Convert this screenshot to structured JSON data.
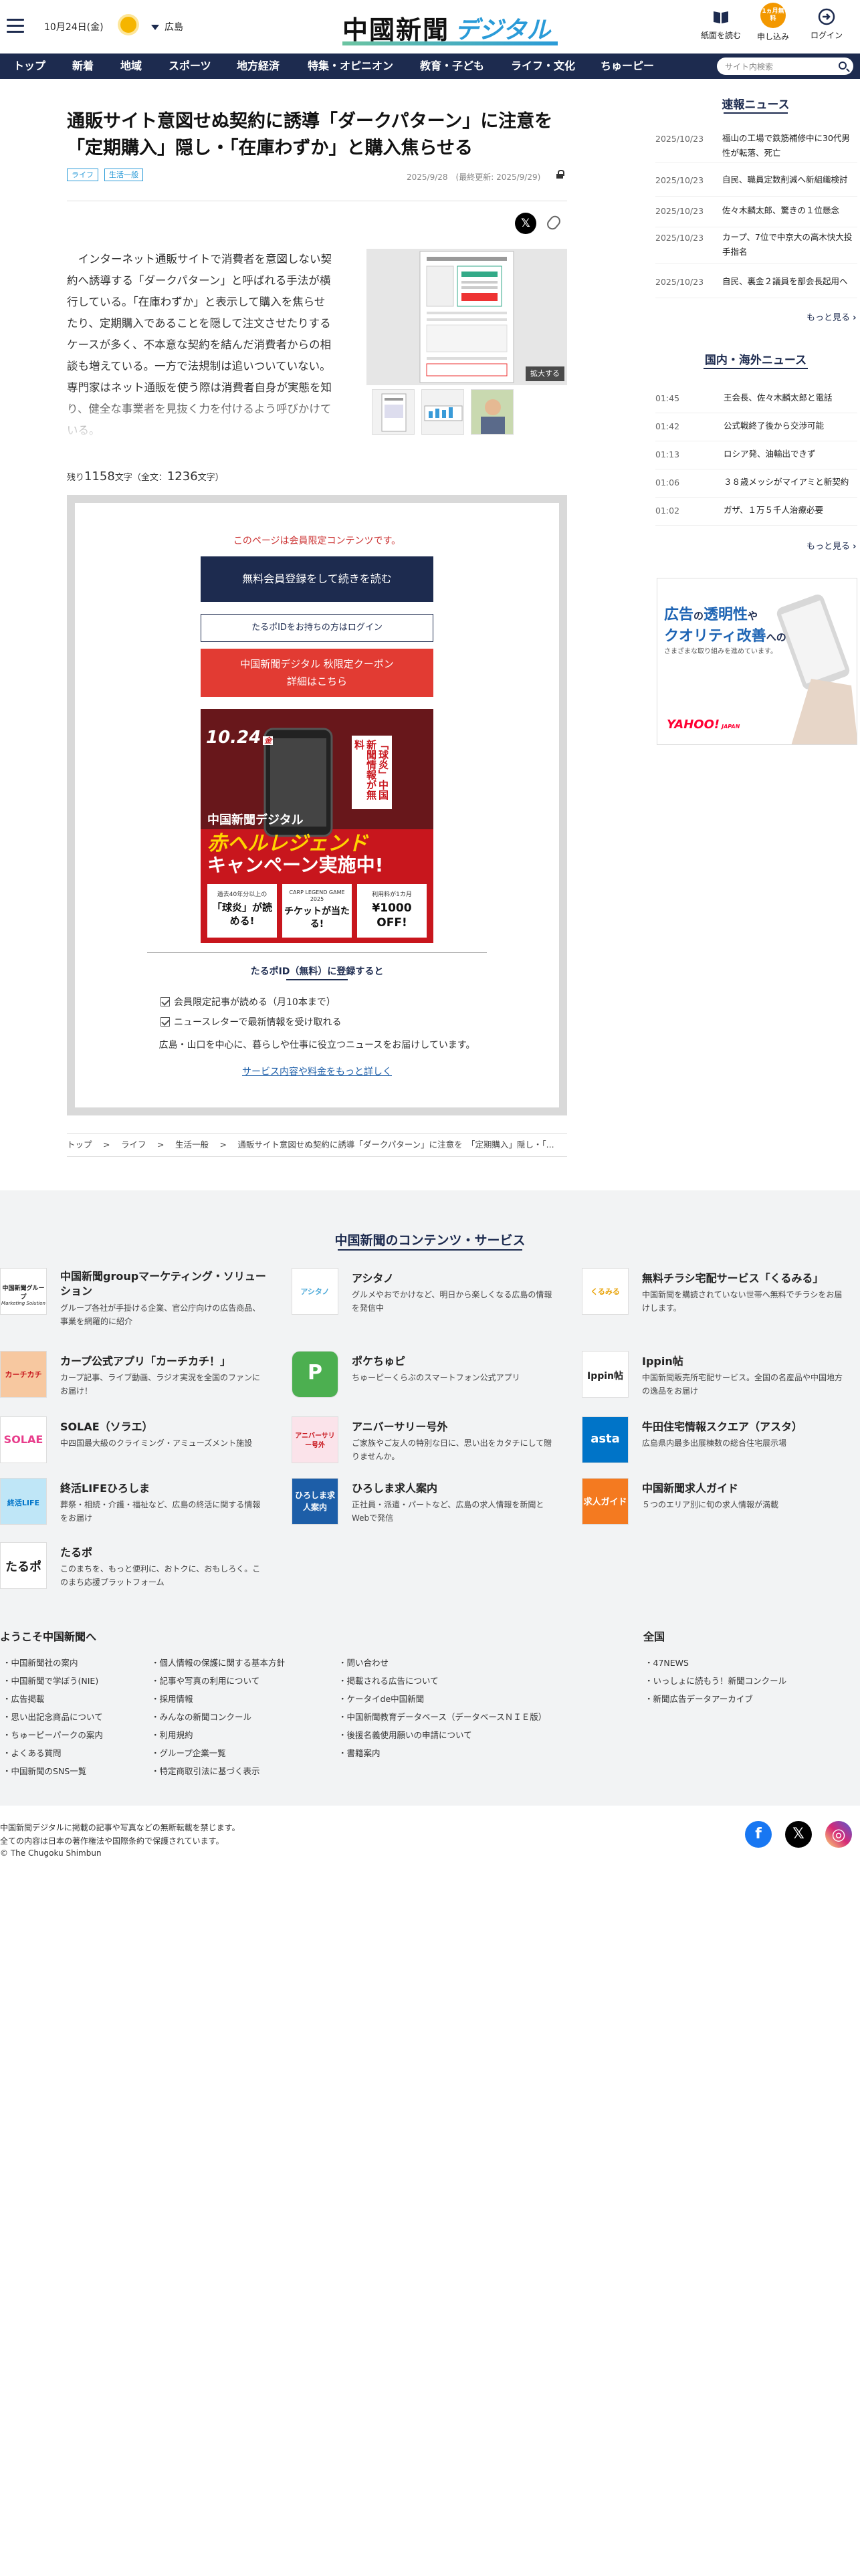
{
  "header": {
    "date": "10月24日(金)",
    "weather_icon": "sun-icon",
    "prefecture": "広島",
    "logo_main": "中國新聞",
    "logo_sub": "デジタル",
    "buttons": [
      {
        "label": "紙面を読む",
        "icon": "newspaper-icon"
      },
      {
        "label": "申し込み",
        "icon": "apply-badge-icon",
        "badge": "1ヵ月無料"
      },
      {
        "label": "ログイン",
        "icon": "login-icon"
      }
    ]
  },
  "nav": {
    "items": [
      "トップ",
      "新着",
      "地域",
      "スポーツ",
      "地方経済",
      "特集・オピニオン",
      "教育・子ども",
      "ライフ・文化",
      "ちゅーピー"
    ],
    "search_placeholder": "サイト内検索"
  },
  "article": {
    "title": "通販サイト意図せぬ契約に誘導「ダークパターン」に注意を　「定期購入」隠し・「在庫わずか」と購入焦らせる",
    "tags": [
      "ライフ",
      "生活一般"
    ],
    "published": "2025/9/28　(最終更新: 2025/9/29)",
    "share_x": "𝕏",
    "lead": "インターネット通販サイトで消費者を意図しない契約へ誘導する「ダークパターン」と呼ばれる手法が横行している。「在庫わずか」と表示して購入を焦らせたり、定期購入であることを隠して注文させたりするケースが多く、不本意な契約を結んだ消費者からの相談も増えている。一方で法規制は追いついていない。専門家はネット通販を使う際は消費者自身が実態を知り、健全な事業者を見抜く力を付けるよう呼びかけている。",
    "expand_label": "拡大する",
    "remaining_prefix": "残り",
    "remaining_count": "1158",
    "remaining_mid": "文字（全文：",
    "total_count": "1236",
    "remaining_suffix": "文字）"
  },
  "paywall": {
    "notice": "このページは会員限定コンテンツです。",
    "register_button": "無料会員登録をして続きを読む",
    "login_button": "たるポIDをお持ちの方はログイン",
    "coupon_line1": "中国新聞デジタル 秋限定クーポン",
    "coupon_line2": "詳細はこちら",
    "promo": {
      "date": "10.24",
      "day": "金",
      "vertical_text": "「球炎」中国新聞情報が無料",
      "brand": "中国新聞デジタル",
      "campaign_red": "赤ヘルレジェンド",
      "campaign": "キャンペーン実施中!",
      "box1_small": "過去40年分以上の",
      "box1_big": "「球炎」が読める!",
      "box2_small": "CARP LEGEND GAME 2025",
      "box2_big": "チケットが当たる!",
      "box3_small": "利用料が1カ月",
      "box3_big": "¥1000 OFF!"
    },
    "benefits_title": "たるポID（無料）に登録すると",
    "benefits": [
      "会員限定記事が読める（月10本まで）",
      "ニュースレターで最新情報を受け取れる"
    ],
    "description": "広島・山口を中心に、暮らしや仕事に役立つニュースをお届けしています。",
    "more_link": "サービス内容や料金をもっと詳しく"
  },
  "breadcrumb": [
    "トップ",
    "ライフ",
    "生活一般",
    "通販サイト意図せぬ契約に誘導「ダークパターン」に注意を　「定期購入」隠し・「..."
  ],
  "sidebar": {
    "breaking_title": "速報ニュース",
    "breaking": [
      {
        "time": "2025/10/23",
        "text": "福山の工場で鉄筋補修中に30代男性が転落、死亡"
      },
      {
        "time": "2025/10/23",
        "text": "自民、職員定数削減へ新組織検討"
      },
      {
        "time": "2025/10/23",
        "text": "佐々木麟太郎、驚きの１位懸念"
      },
      {
        "time": "2025/10/23",
        "text": "カープ、7位で中京大の高木快大投手指名"
      },
      {
        "time": "2025/10/23",
        "text": "自民、裏金２議員を部会長起用へ"
      }
    ],
    "more": "もっと見る",
    "world_title": "国内・海外ニュース",
    "world": [
      {
        "time": "01:45",
        "text": "王会長、佐々木麟太郎と電話"
      },
      {
        "time": "01:42",
        "text": "公式戦終了後から交渉可能"
      },
      {
        "time": "01:13",
        "text": "ロシア発、油輸出できず"
      },
      {
        "time": "01:06",
        "text": "３８歳メッシがマイアミと新契約"
      },
      {
        "time": "01:02",
        "text": "ガザ、１万５千人治療必要"
      }
    ],
    "ad": {
      "line1a": "広告",
      "line1b": "の",
      "line1c": "透明性",
      "line1d": "や",
      "line2a": "クオリティ改善",
      "line2b": "への",
      "line3": "さまざまな取り組みを進めています。",
      "brand": "YAHOO!",
      "brand_sub": "JAPAN"
    }
  },
  "services": {
    "title": "中国新聞のコンテンツ・サービス",
    "items": [
      {
        "name": "中国新聞groupマーケティング・ソリューション",
        "desc": "グループ各社が手掛ける企業、官公庁向けの広告商品、事業を網羅的に紹介",
        "logo": "中国新聞グループ",
        "logo_sub": "Marketing Solution"
      },
      {
        "name": "アシタノ",
        "desc": "グルメやおでかけなど、明日から楽しくなる広島の情報を発信中",
        "logo": "アシタノ"
      },
      {
        "name": "無料チラシ宅配サービス「くるみる」",
        "desc": "中国新聞を購読されていない世帯へ無料でチラシをお届けします。",
        "logo": "くるみる"
      },
      {
        "name": "カープ公式アプリ「カーチカチ！」",
        "desc": "カープ記事、ライブ動画、ラジオ実況を全国のファンにお届け！",
        "logo": "カーチカチ"
      },
      {
        "name": "ポケちゅピ",
        "desc": "ちゅーピーくらぶのスマートフォン公式アプリ",
        "logo": "P"
      },
      {
        "name": "Ippin帖",
        "desc": "中国新聞販売所宅配サービス。全国の名産品や中国地方の逸品をお届け",
        "logo": "Ippin帖"
      },
      {
        "name": "SOLAE（ソラエ）",
        "desc": "中四国最大級のクライミング・アミューズメント施設",
        "logo": "SOLAE"
      },
      {
        "name": "アニバーサリー号外",
        "desc": "ご家族やご友人の特別な日に、思い出をカタチにして贈りませんか。",
        "logo": "アニバーサリー号外"
      },
      {
        "name": "牛田住宅情報スクエア（アスタ）",
        "desc": "広島県内最多出展棟数の総合住宅展示場",
        "logo": "asta"
      },
      {
        "name": "終活LIFEひろしま",
        "desc": "葬祭・相続・介護・福祉など、広島の終活に関する情報をお届け",
        "logo": "終活LIFE"
      },
      {
        "name": "ひろしま求人案内",
        "desc": "正社員・派遣・パートなど、広島の求人情報を新聞とWebで発信",
        "logo": "ひろしま求人案内"
      },
      {
        "name": "中国新聞求人ガイド",
        "desc": "５つのエリア別に旬の求人情報が満載",
        "logo": "求人ガイド"
      },
      {
        "name": "たるポ",
        "desc": "このまちを、もっと便利に、おトクに、おもしろく。このまち応援プラットフォーム",
        "logo": "たるポ"
      }
    ]
  },
  "footer": {
    "welcome_title": "ようこそ中国新聞へ",
    "col1": [
      "中国新聞社の案内",
      "中国新聞で学ぼう(NIE)",
      "広告掲載",
      "思い出記念商品について",
      "ちゅーピーパークの案内",
      "よくある質問",
      "中国新聞のSNS一覧"
    ],
    "col2": [
      "個人情報の保護に関する基本方針",
      "記事や写真の利用について",
      "採用情報",
      "みんなの新聞コンクール",
      "利用規約",
      "グループ企業一覧",
      "特定商取引法に基づく表示"
    ],
    "col3": [
      "問い合わせ",
      "掲載される広告について",
      "ケータイde中国新聞",
      "中国新聞教育データベース（データベースＮＩＥ版）",
      "後援名義使用願いの申請について",
      "書籍案内"
    ],
    "national_title": "全国",
    "national": [
      "47NEWS",
      "いっしょに読もう！新聞コンクール",
      "新聞広告データアーカイブ"
    ],
    "notice1": "中国新聞デジタルに掲載の記事や写真などの無断転載を禁じます。",
    "notice2": "全ての内容は日本の著作権法や国際条約で保護されています。",
    "copyright": "© The Chugoku Shimbun",
    "social": [
      {
        "icon": "facebook-icon",
        "color": "#1877f2",
        "glyph": "f"
      },
      {
        "icon": "x-icon",
        "color": "#000000",
        "glyph": "𝕏"
      },
      {
        "icon": "instagram-icon",
        "color": "#d62976",
        "glyph": "◎"
      }
    ]
  },
  "colors": {
    "navy": "#1d2b4f",
    "accent": "#2a9bd8",
    "red": "#e23b33",
    "orange": "#f39800"
  }
}
